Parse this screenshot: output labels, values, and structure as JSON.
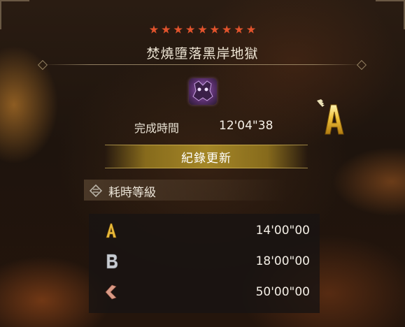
{
  "quest": {
    "stars": 9,
    "star_color": "#e2532c",
    "title": "焚燒墮落黑岸地獄",
    "monster_icon": "monster-crest-icon"
  },
  "result": {
    "time_label": "完成時間",
    "time_value": "12'04\"38",
    "grade": "A",
    "grade_icon": "grade-a-icon",
    "record_label": "紀錄更新"
  },
  "time_ranks": {
    "heading": "耗時等級",
    "heading_icon": "rank-emblem-icon",
    "rows": [
      {
        "grade": "A",
        "icon": "grade-a-icon",
        "time": "14'00\"00",
        "color": "#e8b93a"
      },
      {
        "grade": "B",
        "icon": "grade-b-icon",
        "time": "18'00\"00",
        "color": "#c9ccd2"
      },
      {
        "grade": "C",
        "icon": "grade-c-icon",
        "time": "50'00\"00",
        "color": "#d99a86"
      }
    ]
  }
}
